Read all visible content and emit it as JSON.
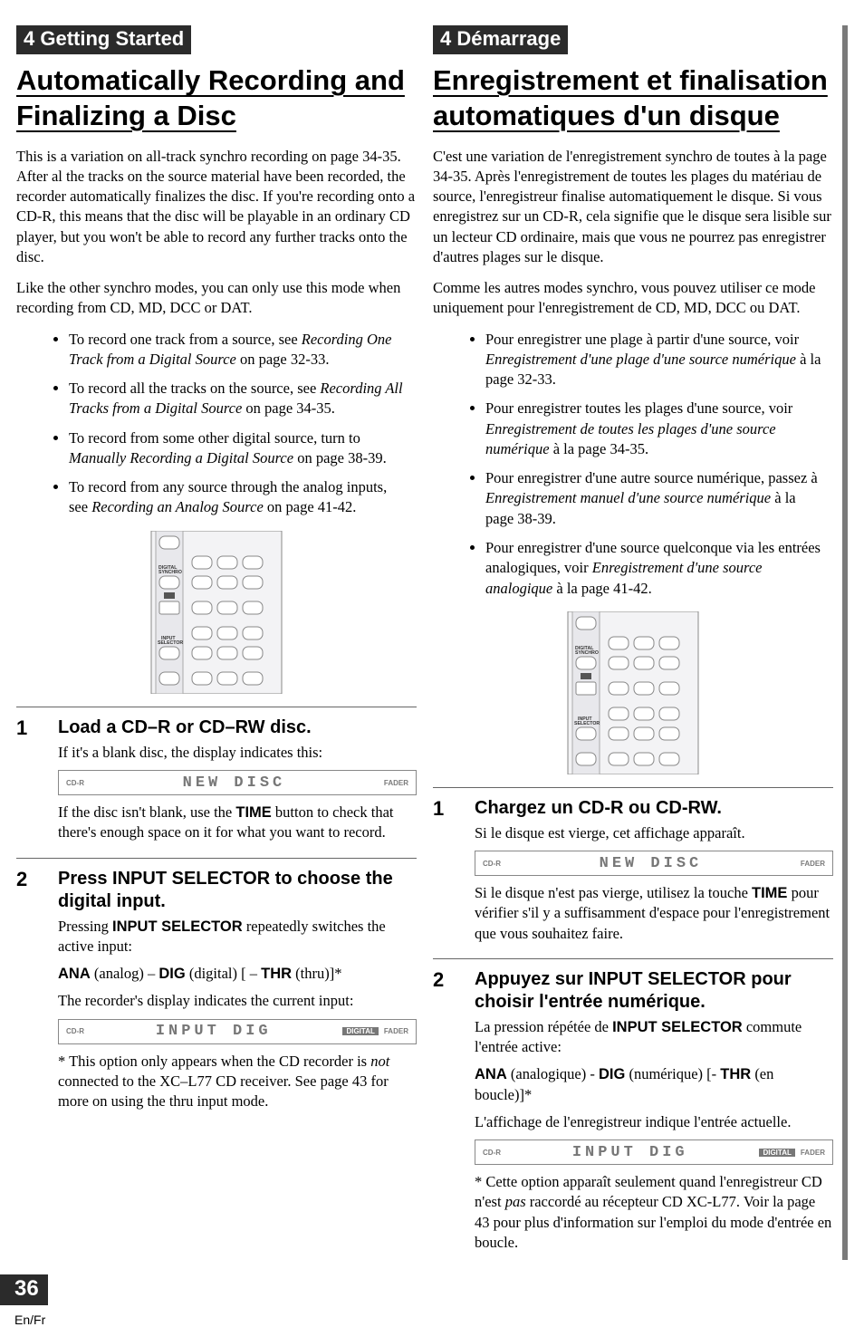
{
  "left": {
    "chapter": "4 Getting Started",
    "title": "Automatically Recording and Finalizing a Disc",
    "p1": "This is a variation on all-track synchro recording on page 34-35. After al the tracks on the source material have been recorded, the recorder automatically finalizes the disc. If you're recording onto a CD-R, this means that the disc will be playable in an ordinary CD player, but you won't be able to record any further tracks onto the disc.",
    "p2": "Like the other synchro modes, you can only use this mode when recording from CD, MD, DCC or DAT.",
    "bullets": [
      {
        "pre": "To record one track from a source, see ",
        "em": "Recording One Track from a Digital Source",
        "post": " on page 32-33."
      },
      {
        "pre": "To record all the tracks on the source, see ",
        "em": "Recording All Tracks from a Digital Source",
        "post": " on page 34-35."
      },
      {
        "pre": "To record from some other digital source, turn to ",
        "em": "Manually Recording a Digital Source",
        "post": " on page 38-39."
      },
      {
        "pre": "To record from any source through the analog inputs, see ",
        "em": "Recording an Analog Source",
        "post": " on page 41-42."
      }
    ],
    "remote": {
      "label1": "DIGITAL SYNCHRO",
      "label2": "INPUT SELECTOR"
    },
    "step1": {
      "no": "1",
      "title": "Load a CD–R or CD–RW disc.",
      "t1": "If it's a blank disc, the display indicates this:",
      "disp": {
        "l": "CD-R",
        "c": "NEW DISC",
        "r": "FADER"
      },
      "t2a": "If the disc isn't blank, use the ",
      "t2b": "TIME",
      "t2c": " button to check that there's enough space on it for what you want to record."
    },
    "step2": {
      "no": "2",
      "title": "Press INPUT SELECTOR to choose the digital input.",
      "t1a": "Pressing ",
      "t1b": "INPUT SELECTOR",
      "t1c": " repeatedly switches the active input:",
      "line_ana": "ANA",
      "line_ana2": " (analog) – ",
      "line_dig": "DIG",
      "line_dig2": " (digital)  [ – ",
      "line_thr": "THR",
      "line_thr2": " (thru)]*",
      "t3": "The recorder's display indicates the current input:",
      "disp": {
        "l": "CD-R",
        "c": "INPUT DIG",
        "dig": "DIGITAL",
        "r": "FADER"
      },
      "note_a": "* This option only appears when the CD recorder is ",
      "note_em": "not",
      "note_b": " connected to the XC–L77 CD receiver. See page 43 for more on using the thru input mode."
    }
  },
  "right": {
    "chapter": "4 Démarrage",
    "title": "Enregistrement et finalisation automatiques d'un disque",
    "p1": "C'est une variation de l'enregistrement synchro de toutes à la page 34-35. Après l'enregistrement de toutes les plages du matériau de source, l'enregistreur finalise automatiquement le disque. Si vous enregistrez sur un CD-R, cela signifie que le disque sera lisible sur un lecteur CD ordinaire, mais que vous ne pourrez pas enregistrer d'autres plages sur le disque.",
    "p2": "Comme les autres modes synchro, vous pouvez utiliser ce mode uniquement pour l'enregistrement de CD, MD, DCC ou DAT.",
    "bullets": [
      {
        "pre": "Pour enregistrer une plage à partir d'une source, voir ",
        "em": "Enregistrement d'une plage d'une source numérique",
        "post": " à la page 32-33."
      },
      {
        "pre": "Pour enregistrer toutes les plages d'une source, voir ",
        "em": "Enregistrement de toutes les plages d'une source numérique",
        "post": " à la page 34-35."
      },
      {
        "pre": "Pour enregistrer d'une autre source numérique, passez à ",
        "em": "Enregistrement manuel d'une source numérique",
        "post": " à la page 38-39."
      },
      {
        "pre": "Pour enregistrer d'une source quelconque via les entrées analogiques, voir ",
        "em": "Enregistrement d'une source analogique",
        "post": " à la page 41-42."
      }
    ],
    "remote": {
      "label1": "DIGITAL SYNCHRO",
      "label2": "INPUT SELECTOR"
    },
    "step1": {
      "no": "1",
      "title": "Chargez un CD-R ou CD-RW.",
      "t1": "Si le disque est vierge, cet affichage apparaît.",
      "disp": {
        "l": "CD-R",
        "c": "NEW DISC",
        "r": "FADER"
      },
      "t2a": "Si le disque n'est pas vierge, utilisez la touche ",
      "t2b": "TIME",
      "t2c": " pour vérifier s'il y a suffisamment d'espace pour l'enregistrement que vous souhaitez faire."
    },
    "step2": {
      "no": "2",
      "title": "Appuyez sur INPUT SELECTOR pour choisir l'entrée numérique.",
      "t1a": "La pression répétée de ",
      "t1b": "INPUT SELECTOR",
      "t1c": " commute l'entrée active:",
      "line_ana": "ANA",
      "line_ana2": " (analogique) - ",
      "line_dig": "DIG",
      "line_dig2": " (numérique) [- ",
      "line_thr": "THR",
      "line_thr2": " (en boucle)]*",
      "t3": "L'affichage de l'enregistreur indique l'entrée actuelle.",
      "disp": {
        "l": "CD-R",
        "c": "INPUT DIG",
        "dig": "DIGITAL",
        "r": "FADER"
      },
      "note_a": "* Cette option apparaît seulement quand l'enregistreur CD n'est ",
      "note_em": "pas",
      "note_b": " raccordé au récepteur CD XC-L77. Voir la page 43 pour plus d'information sur l'emploi du mode d'entrée en boucle."
    }
  },
  "page_number": "36",
  "page_lang": "En/Fr"
}
